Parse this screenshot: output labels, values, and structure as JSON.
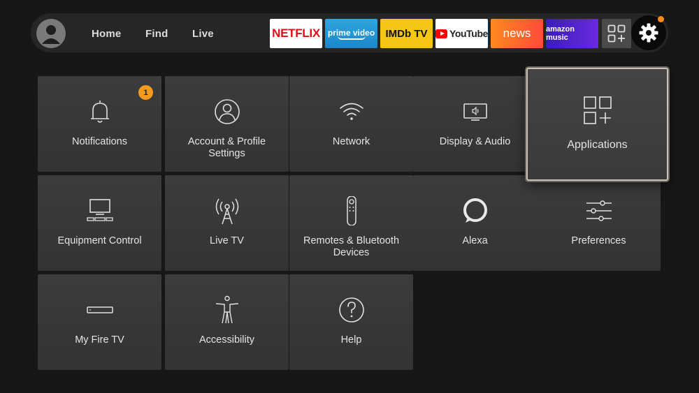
{
  "nav": {
    "home": "Home",
    "find": "Find",
    "live": "Live"
  },
  "apps": {
    "netflix": "NETFLIX",
    "prime": "prime video",
    "imdb": "IMDb TV",
    "youtube": "YouTube",
    "news": "news",
    "music": "amazon music"
  },
  "notifications_badge": "1",
  "tiles": [
    {
      "label": "Notifications",
      "icon": "bell-icon"
    },
    {
      "label": "Account & Profile Settings",
      "icon": "user-circle-icon"
    },
    {
      "label": "Network",
      "icon": "wifi-icon"
    },
    {
      "label": "Display & Audio",
      "icon": "tv-speaker-icon"
    },
    {
      "label": "Applications",
      "icon": "apps-grid-icon"
    },
    {
      "label": "Equipment Control",
      "icon": "tv-equipment-icon"
    },
    {
      "label": "Live TV",
      "icon": "antenna-icon"
    },
    {
      "label": "Remotes & Bluetooth Devices",
      "icon": "remote-icon"
    },
    {
      "label": "Alexa",
      "icon": "alexa-ring-icon"
    },
    {
      "label": "Preferences",
      "icon": "sliders-icon"
    },
    {
      "label": "My Fire TV",
      "icon": "fire-tv-device-icon"
    },
    {
      "label": "Accessibility",
      "icon": "accessibility-person-icon"
    },
    {
      "label": "Help",
      "icon": "help-circle-icon"
    }
  ],
  "focused_tile": "Applications",
  "colors": {
    "background": "#171717",
    "tile": "#3a3a3a",
    "badge": "#f39a1f",
    "settings_dot": "#ff8c1a"
  }
}
